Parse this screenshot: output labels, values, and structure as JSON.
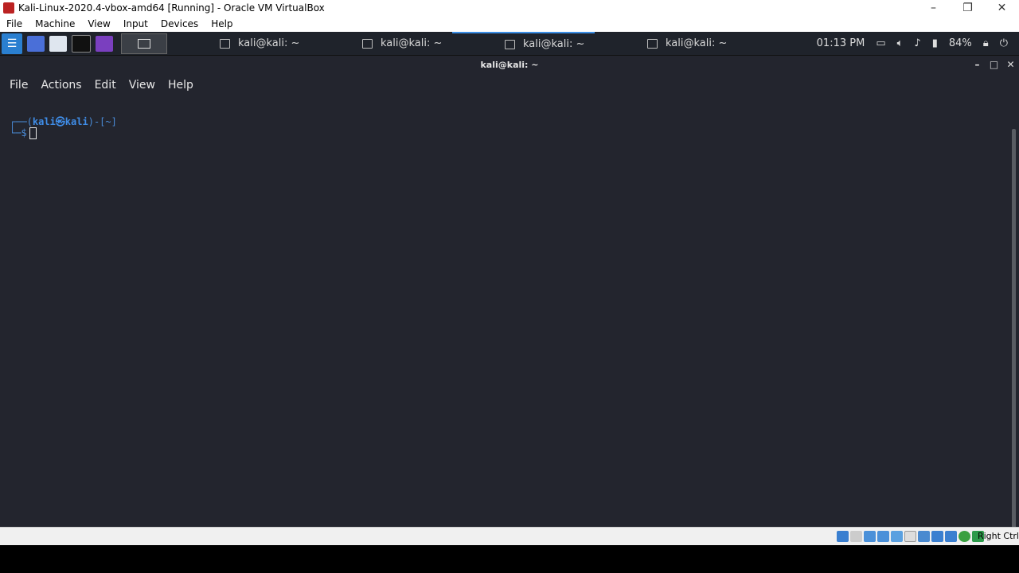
{
  "host": {
    "title": "Kali-Linux-2020.4-vbox-amd64 [Running] - Oracle VM VirtualBox",
    "window_controls": [
      "–",
      "❐",
      "✕"
    ],
    "menu": [
      "File",
      "Machine",
      "View",
      "Input",
      "Devices",
      "Help"
    ],
    "host_key": "Right Ctrl"
  },
  "panel": {
    "tasks": [
      {
        "label": "kali@kali: ~"
      },
      {
        "label": "kali@kali: ~"
      },
      {
        "label": "kali@kali: ~"
      },
      {
        "label": "kali@kali: ~"
      }
    ],
    "clock": "01:13 PM",
    "battery": "84%"
  },
  "terminal": {
    "title": "kali@kali: ~",
    "menu": [
      "File",
      "Actions",
      "Edit",
      "View",
      "Help"
    ],
    "prompt_line1_prefix": "┌──(",
    "prompt_user": "kali㉿kali",
    "prompt_line1_suffix": ")-[~]",
    "prompt_line2": "└─$"
  },
  "colors": {
    "accent": "#3a8ee6",
    "terminal_bg": "#23252e",
    "panel_bg": "#1f232b"
  }
}
